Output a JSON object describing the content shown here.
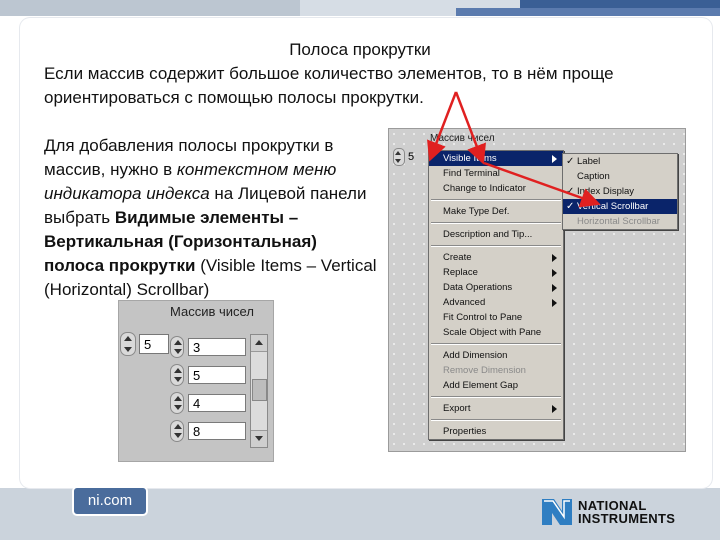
{
  "header": {
    "colors": {
      "strip_light": "#bcc6d1",
      "strip_blue": "#3a5f95"
    }
  },
  "slide": {
    "title": "Полоса прокрутки",
    "intro": "Если массив содержит большое количество элементов, то в нём проще ориентироваться с помощью полосы прокрутки.",
    "body": {
      "p1": "Для добавления полосы прокрутки в массив, нужно в ",
      "p2_italic": "контекстном меню индикатора индекса",
      "p3": " на Лицевой панели выбрать ",
      "p4_bold": "Видимые элементы – Вертикальная (Горизонтальная) полоса прокрутки",
      "p5": " (Visible Items – Vertical (Horizontal) Scrollbar)"
    }
  },
  "array_panel": {
    "title": "Массив чисел",
    "index_value": "5",
    "elements": [
      "3",
      "5",
      "4",
      "8"
    ],
    "scroll_icon": "vertical-scrollbar-icon"
  },
  "context_shot": {
    "array_label": "Массив чисел",
    "index_value": "5",
    "menu_items": [
      {
        "label": "Visible Items",
        "submenu": true,
        "selected": true
      },
      {
        "label": "Find Terminal"
      },
      {
        "label": "Change to Indicator"
      },
      {
        "sep": true
      },
      {
        "label": "Make Type Def."
      },
      {
        "sep": true
      },
      {
        "label": "Description and Tip..."
      },
      {
        "sep": true
      },
      {
        "label": "Create",
        "submenu": true
      },
      {
        "label": "Replace",
        "submenu": true
      },
      {
        "label": "Data Operations",
        "submenu": true
      },
      {
        "label": "Advanced",
        "submenu": true
      },
      {
        "label": "Fit Control to Pane"
      },
      {
        "label": "Scale Object with Pane"
      },
      {
        "sep": true
      },
      {
        "label": "Add Dimension"
      },
      {
        "label": "Remove Dimension",
        "disabled": true
      },
      {
        "label": "Add Element Gap"
      },
      {
        "sep": true
      },
      {
        "label": "Export",
        "submenu": true
      },
      {
        "sep": true
      },
      {
        "label": "Properties"
      }
    ],
    "submenu_items": [
      {
        "label": "Label",
        "checked": true
      },
      {
        "label": "Caption"
      },
      {
        "label": "Index Display",
        "checked": true
      },
      {
        "label": "Vertical Scrollbar",
        "checked": true,
        "selected": true
      },
      {
        "label": "Horizontal Scrollbar",
        "disabled": true
      }
    ]
  },
  "footer": {
    "site": "ni.com",
    "brand_line1": "NATIONAL",
    "brand_line2": "INSTRUMENTS",
    "brand_icon": "ni-eagle-logo-icon"
  },
  "colors": {
    "menu_bg": "#d4d0c8",
    "menu_select": "#0a246a",
    "annotation_arrow": "#e02020"
  }
}
